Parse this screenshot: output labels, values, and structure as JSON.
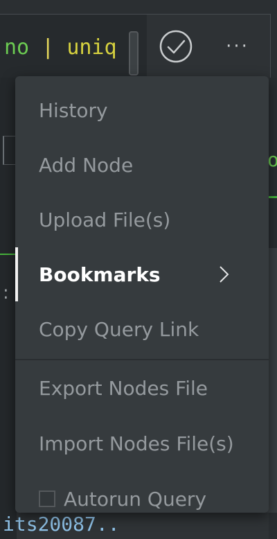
{
  "query": {
    "text_green": "no",
    "text_pipe": " | ",
    "text_yellow": "uniq"
  },
  "toolbar": {
    "run_icon": "check-circle-icon",
    "more_label": "···"
  },
  "background": {
    "fragment_bottom": "its20087..",
    "fragment_colon": ":",
    "fragment_green": "o"
  },
  "menu": {
    "items": [
      {
        "label": "History"
      },
      {
        "label": "Add Node"
      },
      {
        "label": "Upload File(s)"
      },
      {
        "label": "Bookmarks",
        "active": true,
        "has_submenu": true
      },
      {
        "label": "Copy Query Link"
      },
      {
        "label": "Export Nodes File"
      },
      {
        "label": "Import Nodes File(s)"
      },
      {
        "label": "Autorun Query",
        "checkbox": true,
        "checked": false
      }
    ]
  },
  "colors": {
    "accent_green": "#6ccb52",
    "accent_yellow": "#d7d23f",
    "menu_bg": "#363b3e",
    "menu_text": "#959a9e",
    "menu_text_active": "#ffffff"
  }
}
